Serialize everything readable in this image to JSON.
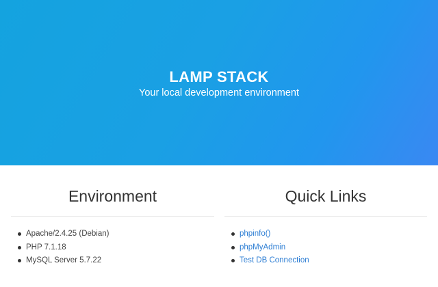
{
  "hero": {
    "title": "LAMP STACK",
    "subtitle": "Your local development environment",
    "gradient_colors": [
      "#14a3df",
      "#3a88f2"
    ]
  },
  "environment": {
    "heading": "Environment",
    "items": [
      {
        "label": "Apache/2.4.25 (Debian)"
      },
      {
        "label": "PHP 7.1.18"
      },
      {
        "label": "MySQL Server 5.7.22"
      }
    ]
  },
  "quick_links": {
    "heading": "Quick Links",
    "link_color": "#2f7fd4",
    "items": [
      {
        "label": "phpinfo()"
      },
      {
        "label": "phpMyAdmin"
      },
      {
        "label": "Test DB Connection"
      }
    ]
  }
}
